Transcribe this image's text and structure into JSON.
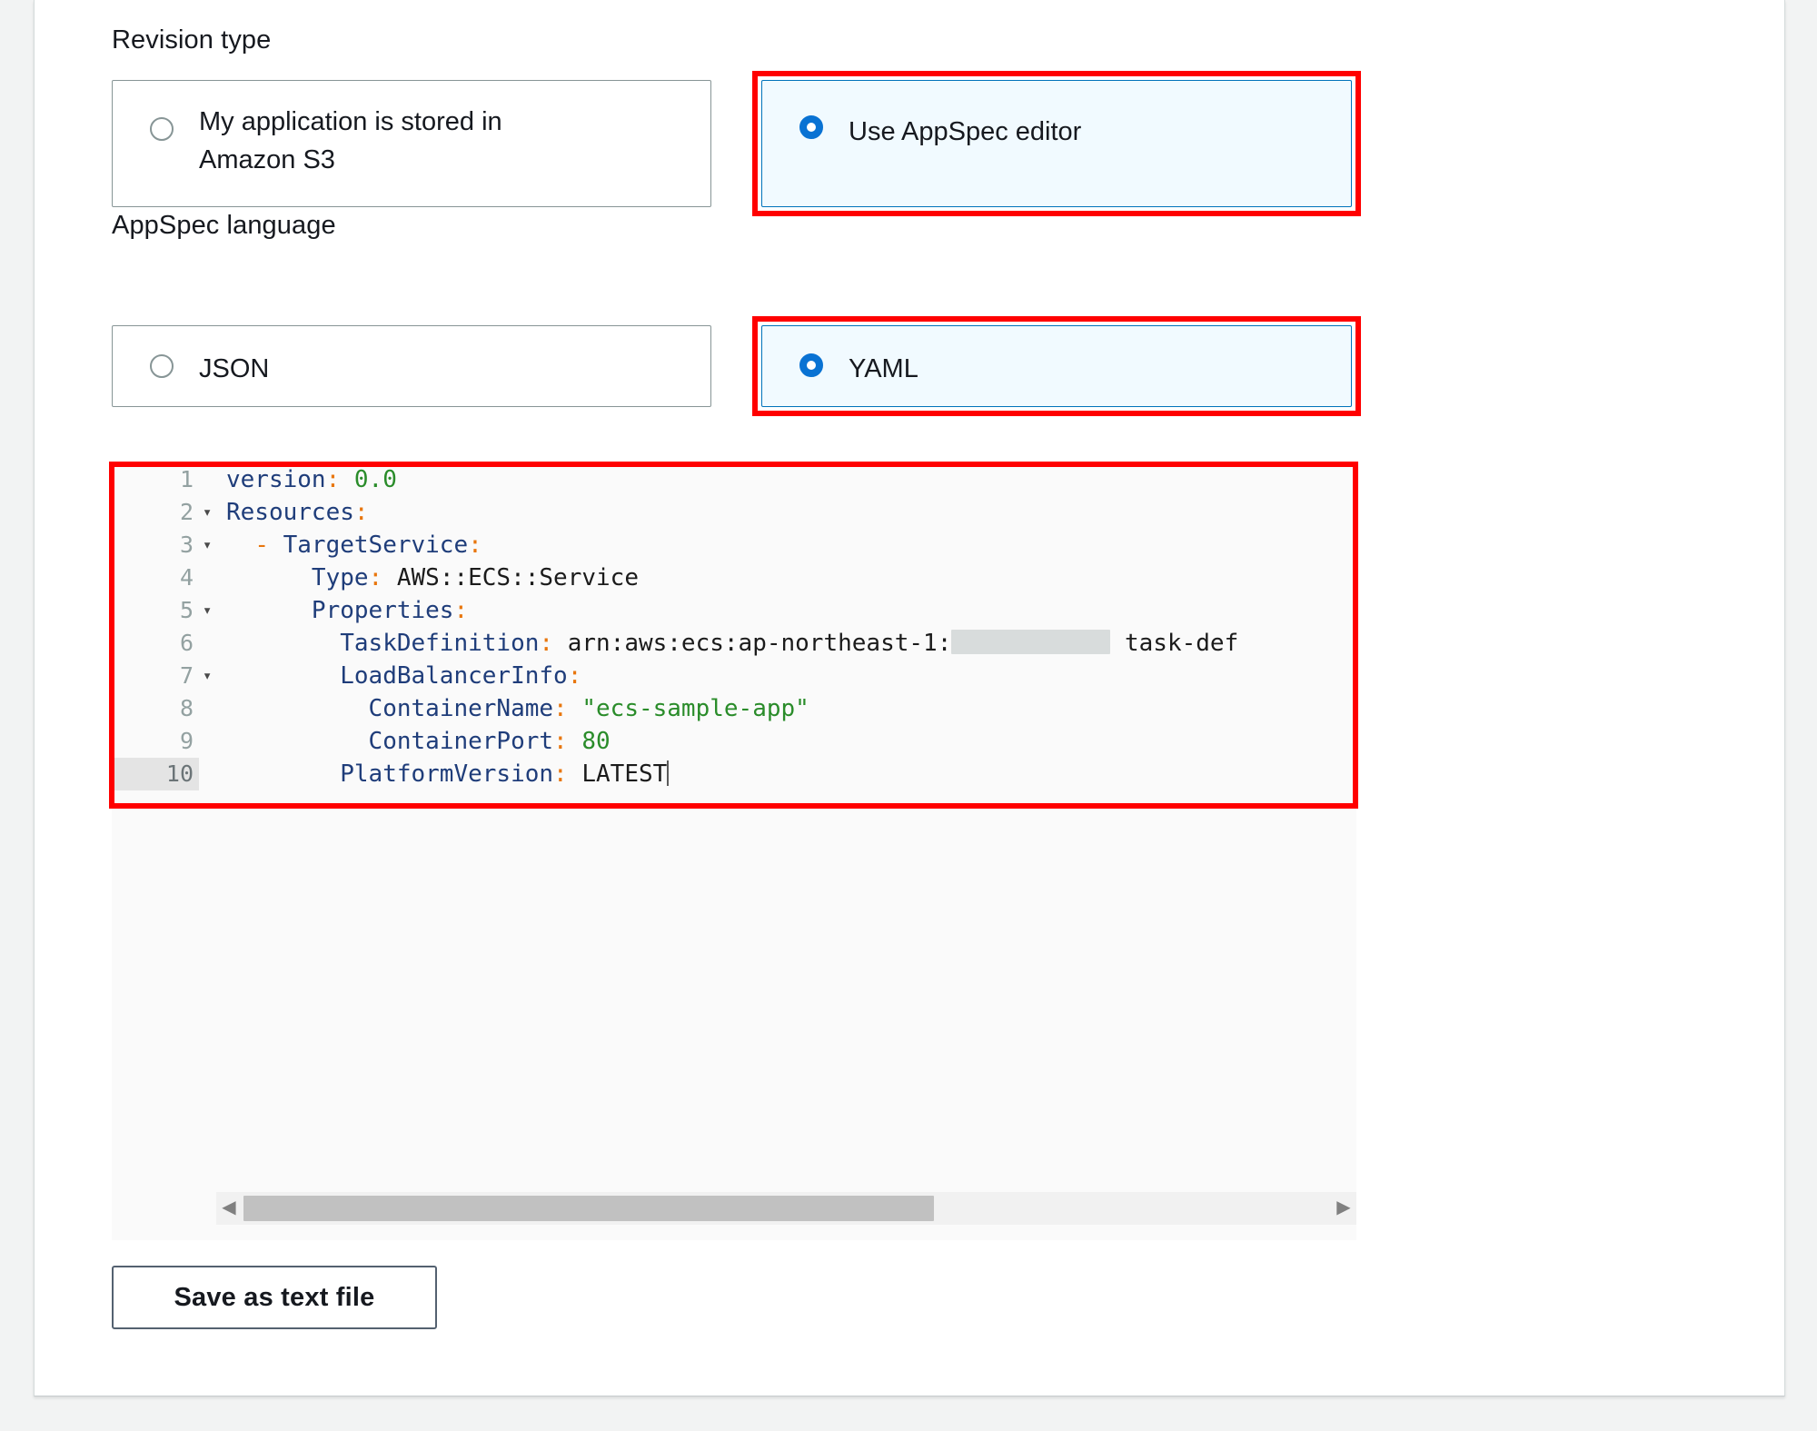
{
  "revision_type": {
    "label": "Revision type",
    "options": [
      {
        "id": "s3",
        "label": "My application is stored in\nAmazon S3",
        "selected": false
      },
      {
        "id": "appspec-editor",
        "label": "Use AppSpec editor",
        "selected": true
      }
    ]
  },
  "appspec_language": {
    "label": "AppSpec language",
    "options": [
      {
        "id": "json",
        "label": "JSON",
        "selected": false
      },
      {
        "id": "yaml",
        "label": "YAML",
        "selected": true
      }
    ]
  },
  "editor": {
    "language": "YAML",
    "active_line": 10,
    "lines": [
      {
        "number": "1",
        "fold": "",
        "text": "version: 0.0"
      },
      {
        "number": "2",
        "fold": "▾",
        "text": "Resources:"
      },
      {
        "number": "3",
        "fold": "▾",
        "text": "  - TargetService:"
      },
      {
        "number": "4",
        "fold": "",
        "text": "      Type: AWS::ECS::Service"
      },
      {
        "number": "5",
        "fold": "▾",
        "text": "      Properties:"
      },
      {
        "number": "6",
        "fold": "",
        "text": "        TaskDefinition: arn:aws:ecs:ap-northeast-1:[redacted] task-def"
      },
      {
        "number": "7",
        "fold": "▾",
        "text": "        LoadBalancerInfo:"
      },
      {
        "number": "8",
        "fold": "",
        "text": "          ContainerName: \"ecs-sample-app\""
      },
      {
        "number": "9",
        "fold": "",
        "text": "          ContainerPort: 80"
      },
      {
        "number": "10",
        "fold": "",
        "text": "        PlatformVersion: LATEST"
      }
    ],
    "scrollbar": {
      "left_arrow": "◀",
      "right_arrow": "▶"
    }
  },
  "save_button": {
    "label": "Save as text file"
  },
  "colors": {
    "selected_tile_background": "#f1faff",
    "selected_radio": "#0972d3",
    "annotation_border": "#ff0000",
    "editor_background": "#fafafa",
    "yaml_key": "#1f3d7a",
    "yaml_colon": "#e8760d",
    "yaml_value": "#2a8c2a",
    "redaction_block": "#d8dcdc"
  }
}
